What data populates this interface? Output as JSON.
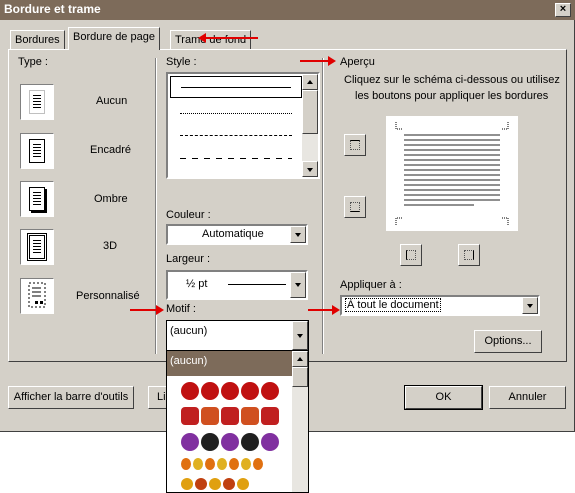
{
  "window": {
    "title": "Bordure et trame",
    "close_glyph": "×"
  },
  "tabs": [
    {
      "label": "Bordures",
      "active": false
    },
    {
      "label": "Bordure de page",
      "active": true
    },
    {
      "label": "Trame de fond",
      "active": false
    }
  ],
  "type_section": {
    "label": "Type :",
    "items": [
      {
        "label": "Aucun",
        "icon": "page-none-icon"
      },
      {
        "label": "Encadré",
        "icon": "page-box-icon"
      },
      {
        "label": "Ombre",
        "icon": "page-shadow-icon"
      },
      {
        "label": "3D",
        "icon": "page-3d-icon"
      },
      {
        "label": "Personnalisé",
        "icon": "page-custom-icon"
      }
    ]
  },
  "style_section": {
    "label": "Style :",
    "styles": [
      "solid",
      "dotted",
      "dashed",
      "long-dash"
    ]
  },
  "couleur": {
    "label": "Couleur :",
    "value": "Automatique"
  },
  "largeur": {
    "label": "Largeur :",
    "value": "½ pt"
  },
  "motif": {
    "label": "Motif :",
    "value": "(aucun)",
    "options": [
      "(aucun)"
    ],
    "art_icons": [
      "red-balloon-icon",
      "heart-basket-icon",
      "purple-candy-icon",
      "flame-icon",
      "fruit-icon"
    ]
  },
  "apercu": {
    "label": "Aperçu",
    "instruction_line1": "Cliquez sur le schéma ci-dessous ou utilisez",
    "instruction_line2": "les boutons pour appliquer les bordures"
  },
  "appliquer": {
    "label": "Appliquer à :",
    "value": "À tout le document"
  },
  "buttons": {
    "options": "Options...",
    "toolbar": "Afficher la barre d'outils",
    "ligne": "Li",
    "ok": "OK",
    "cancel": "Annuler"
  },
  "colors": {
    "titlebar": "#7d6b5a",
    "dialog_bg": "#d4d0c8",
    "annotation_arrow": "#e00000"
  }
}
